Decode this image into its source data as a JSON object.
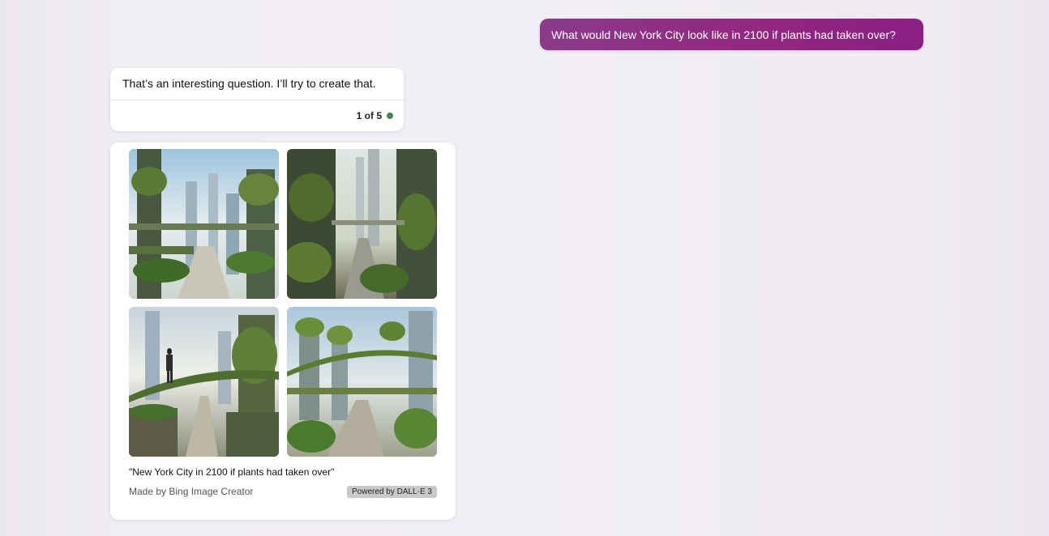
{
  "user_message": "What would New York City look like in 2100 if plants had taken over?",
  "bot_message": {
    "text": "That’s an interesting question. I’ll try to create that.",
    "pager": "1 of 5",
    "status_color": "#3a8a4a"
  },
  "image_result": {
    "images": [
      {
        "description": "overgrown skyscrapers with elevated garden walkways"
      },
      {
        "description": "vine covered towers with a bridge over a street"
      },
      {
        "description": "woman walking on a green elevated path"
      },
      {
        "description": "tree topped towers with green bridges over a boulevard"
      }
    ],
    "caption": "\"New York City in 2100 if plants had taken over\"",
    "made_by": "Made by Bing Image Creator",
    "powered_by": "Powered by DALL·E 3"
  },
  "colors": {
    "user_bubble": "#8f2a85",
    "background": "#f1eef3"
  }
}
